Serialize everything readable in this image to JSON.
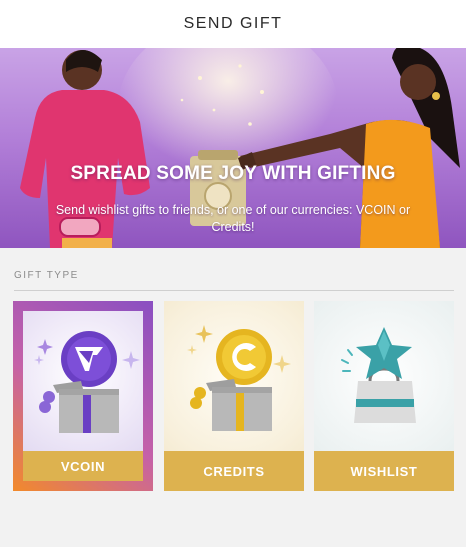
{
  "header": {
    "title": "SEND GIFT"
  },
  "banner": {
    "headline": "SPREAD SOME JOY WITH GIFTING",
    "subtitle": "Send wishlist gifts to friends, or one of our currencies: VCOIN or Credits!"
  },
  "gift_type": {
    "label": "GIFT TYPE",
    "options": [
      {
        "label": "VCOIN",
        "icon": "vcoin-gift-icon",
        "selected": true
      },
      {
        "label": "CREDITS",
        "icon": "credits-gift-icon",
        "selected": false
      },
      {
        "label": "WISHLIST",
        "icon": "wishlist-bag-icon",
        "selected": false
      }
    ]
  },
  "colors": {
    "accent_gold": "#ddb24f",
    "vcoin_purple": "#6a3fc4",
    "credits_gold": "#e5b520",
    "wishlist_teal": "#3aa1a7",
    "banner_purple": "#b27fd8"
  }
}
